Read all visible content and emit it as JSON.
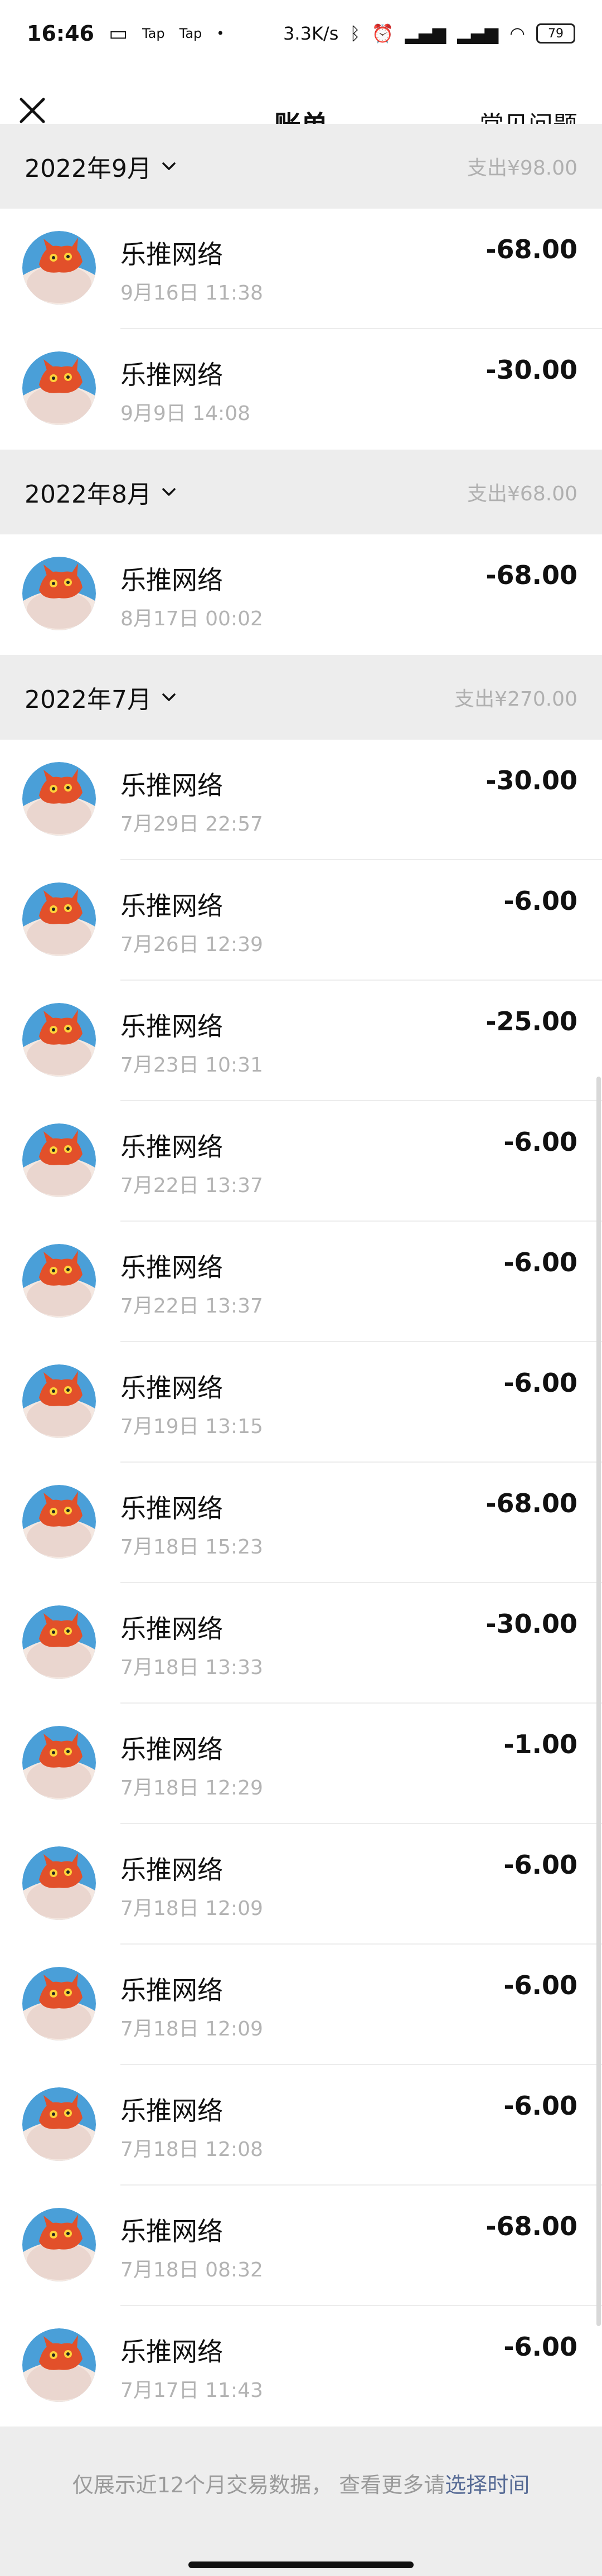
{
  "statusbar": {
    "time": "16:46",
    "notif1": "Tap",
    "notif2": "Tap",
    "dot": "•",
    "speed": "3.3K/s",
    "battery": "79"
  },
  "header": {
    "title": "账单",
    "faq_label": "常见问题"
  },
  "months": [
    {
      "label": "2022年9月",
      "total": "支出¥98.00",
      "items": [
        {
          "merchant": "乐推网络",
          "datetime": "9月16日 11:38",
          "amount": "-68.00"
        },
        {
          "merchant": "乐推网络",
          "datetime": "9月9日 14:08",
          "amount": "-30.00"
        }
      ]
    },
    {
      "label": "2022年8月",
      "total": "支出¥68.00",
      "items": [
        {
          "merchant": "乐推网络",
          "datetime": "8月17日 00:02",
          "amount": "-68.00"
        }
      ]
    },
    {
      "label": "2022年7月",
      "total": "支出¥270.00",
      "items": [
        {
          "merchant": "乐推网络",
          "datetime": "7月29日 22:57",
          "amount": "-30.00"
        },
        {
          "merchant": "乐推网络",
          "datetime": "7月26日 12:39",
          "amount": "-6.00"
        },
        {
          "merchant": "乐推网络",
          "datetime": "7月23日 10:31",
          "amount": "-25.00"
        },
        {
          "merchant": "乐推网络",
          "datetime": "7月22日 13:37",
          "amount": "-6.00"
        },
        {
          "merchant": "乐推网络",
          "datetime": "7月22日 13:37",
          "amount": "-6.00"
        },
        {
          "merchant": "乐推网络",
          "datetime": "7月19日 13:15",
          "amount": "-6.00"
        },
        {
          "merchant": "乐推网络",
          "datetime": "7月18日 15:23",
          "amount": "-68.00"
        },
        {
          "merchant": "乐推网络",
          "datetime": "7月18日 13:33",
          "amount": "-30.00"
        },
        {
          "merchant": "乐推网络",
          "datetime": "7月18日 12:29",
          "amount": "-1.00"
        },
        {
          "merchant": "乐推网络",
          "datetime": "7月18日 12:09",
          "amount": "-6.00"
        },
        {
          "merchant": "乐推网络",
          "datetime": "7月18日 12:09",
          "amount": "-6.00"
        },
        {
          "merchant": "乐推网络",
          "datetime": "7月18日 12:08",
          "amount": "-6.00"
        },
        {
          "merchant": "乐推网络",
          "datetime": "7月18日 08:32",
          "amount": "-68.00"
        },
        {
          "merchant": "乐推网络",
          "datetime": "7月17日 11:43",
          "amount": "-6.00"
        }
      ]
    }
  ],
  "footer": {
    "text": "仅展示近12个月交易数据， 查看更多请",
    "link": "选择时间"
  },
  "icons": {
    "close": "close-icon",
    "chevron": "chevron-down-icon",
    "avatar": "merchant-avatar"
  }
}
